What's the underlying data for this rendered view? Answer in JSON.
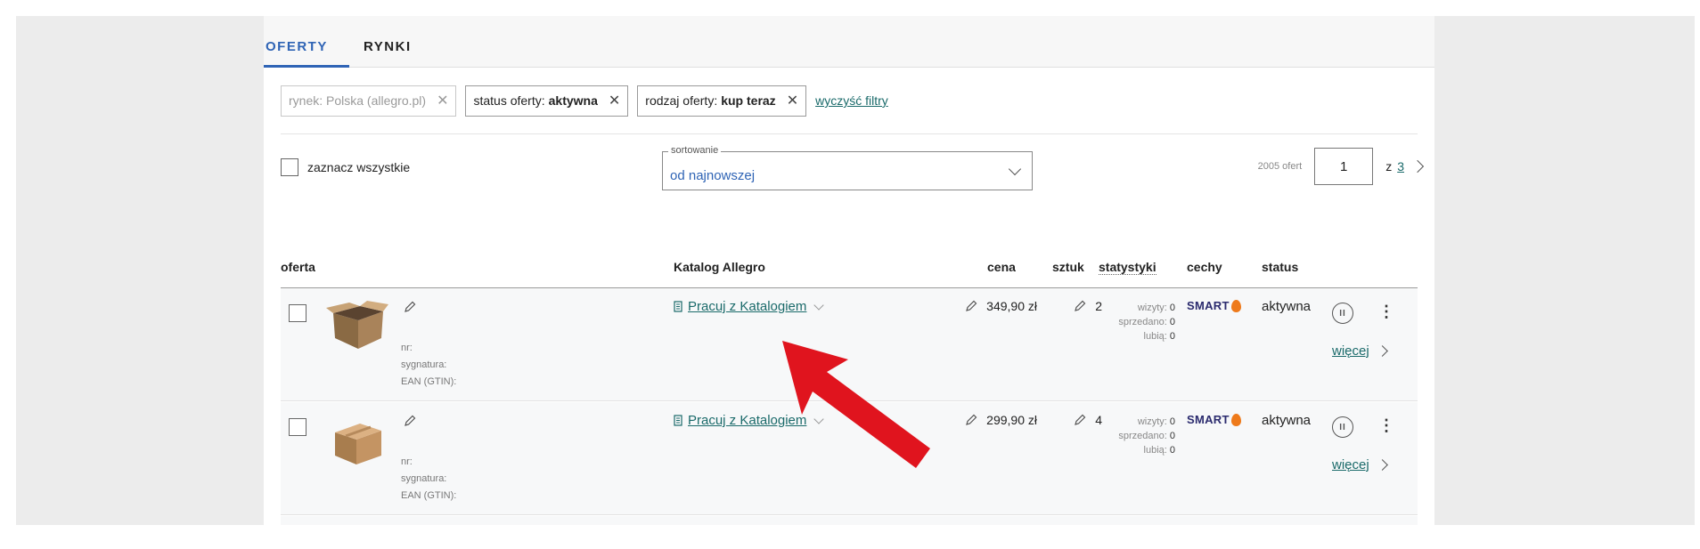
{
  "tabs": [
    {
      "label": "OFERTY",
      "active": true
    },
    {
      "label": "RYNKI",
      "active": false
    }
  ],
  "filters": {
    "chips": [
      {
        "label": "rynek: Polska (allegro.pl)",
        "value": "",
        "disabled": true
      },
      {
        "label": "status oferty:",
        "value": "aktywna",
        "disabled": false
      },
      {
        "label": "rodzaj oferty:",
        "value": "kup teraz",
        "disabled": false
      }
    ],
    "clear_label": "wyczyść filtry"
  },
  "toolbar": {
    "select_all_label": "zaznacz wszystkie",
    "sort_legend": "sortowanie",
    "sort_value": "od najnowszej",
    "offer_count": "2005 ofert",
    "page_current": "1",
    "page_of": "z",
    "page_total": "3"
  },
  "table": {
    "headers": {
      "offer": "oferta",
      "catalog": "Katalog Allegro",
      "price": "cena",
      "qty": "sztuk",
      "stats": "statystyki",
      "features": "cechy",
      "status": "status"
    },
    "rows": [
      {
        "nr_label": "nr:",
        "signature_label": "sygnatura:",
        "ean_label": "EAN (GTIN):",
        "catalog_link": "Pracuj z Katalogiem",
        "price": "349,90 zł",
        "qty": "2",
        "stats": {
          "visits_label": "wizyty:",
          "visits": "0",
          "sold_label": "sprzedano:",
          "sold": "0",
          "likes_label": "lubią:",
          "likes": "0"
        },
        "badge": "SMART",
        "status": "aktywna",
        "pause_icon": "pause-icon",
        "more_label": "więcej"
      },
      {
        "nr_label": "nr:",
        "signature_label": "sygnatura:",
        "ean_label": "EAN (GTIN):",
        "catalog_link": "Pracuj z Katalogiem",
        "price": "299,90 zł",
        "qty": "4",
        "stats": {
          "visits_label": "wizyty:",
          "visits": "0",
          "sold_label": "sprzedano:",
          "sold": "0",
          "likes_label": "lubią:",
          "likes": "0"
        },
        "badge": "SMART",
        "status": "aktywna",
        "pause_icon": "pause-icon",
        "more_label": "więcej"
      }
    ]
  },
  "colors": {
    "accent": "#2f64b5",
    "link": "#1a6a6a",
    "smart_orange": "#ee7a1b",
    "annotation_arrow": "#e0141e"
  },
  "icons": [
    "pencil-icon",
    "catalog-icon",
    "chevron-down-icon",
    "chevron-right-icon",
    "close-icon",
    "pause-icon",
    "kebab-menu-icon",
    "box-thumbnail",
    "red-arrow-annotation"
  ]
}
